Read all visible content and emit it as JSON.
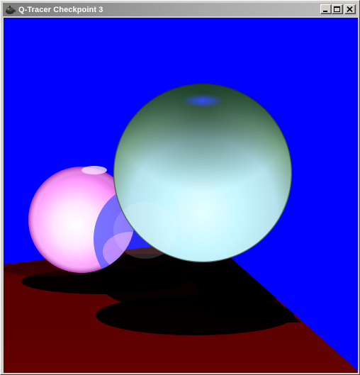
{
  "window": {
    "title": "Q-Tracer Checkpoint 3",
    "app_icon": "teapot-icon",
    "buttons": [
      {
        "name": "minimize-button",
        "icon": "minimize-icon"
      },
      {
        "name": "maximize-button",
        "icon": "maximize-icon"
      },
      {
        "name": "close-button",
        "icon": "close-icon"
      }
    ]
  },
  "scene": {
    "background_color": "#0000ff",
    "floor_color": "#990000",
    "objects": [
      {
        "name": "pink-sphere",
        "color": "#ff80ff"
      },
      {
        "name": "green-glass-sphere",
        "color": "#c0ffff"
      }
    ]
  }
}
